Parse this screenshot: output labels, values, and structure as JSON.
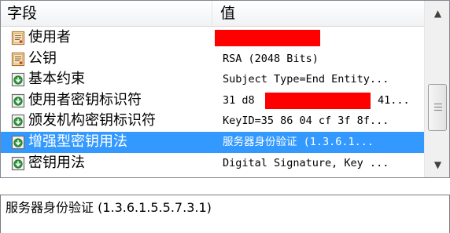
{
  "list": {
    "headers": {
      "field": "字段",
      "value": "值"
    },
    "rows": [
      {
        "field": "使用者",
        "value": "",
        "icon": "certificate-icon",
        "redacted": true
      },
      {
        "field": "公钥",
        "value": "RSA (2048 Bits)",
        "icon": "certificate-icon"
      },
      {
        "field": "基本约束",
        "value": "Subject Type=End Entity...",
        "icon": "extension-icon"
      },
      {
        "field": "使用者密钥标识符",
        "value": "31 d8",
        "value_tail": "41...",
        "icon": "extension-icon",
        "redacted": true
      },
      {
        "field": "颁发机构密钥标识符",
        "value": "KeyID=35 86 04 cf 3f 8f...",
        "icon": "extension-icon"
      },
      {
        "field": "增强型密钥用法",
        "value": "服务器身份验证 (1.3.6.1...",
        "icon": "extension-icon",
        "selected": true
      },
      {
        "field": "密钥用法",
        "value": "Digital Signature, Key ...",
        "icon": "extension-icon"
      }
    ]
  },
  "scrollbar": {
    "up_icon": "scroll-up-arrow-icon",
    "down_icon": "scroll-down-arrow-icon"
  },
  "detail": {
    "text": "服务器身份验证 (1.3.6.1.5.5.7.3.1)"
  },
  "colors": {
    "selection": "#3399ff",
    "redaction": "#ff0000",
    "border": "#828790"
  }
}
